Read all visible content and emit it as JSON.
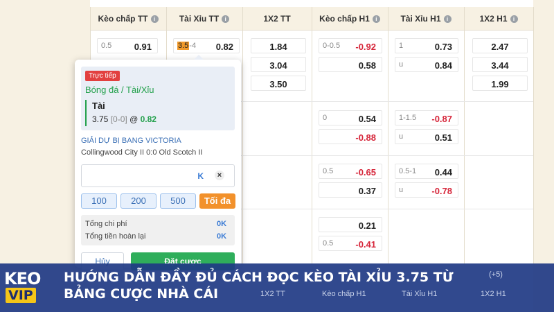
{
  "columns": [
    {
      "label": "Kèo chấp TT",
      "info": true
    },
    {
      "label": "Tài Xỉu TT",
      "info": true
    },
    {
      "label": "1X2 TT",
      "info": false
    },
    {
      "label": "Kèo chấp H1",
      "info": true
    },
    {
      "label": "Tài Xỉu H1",
      "info": true
    },
    {
      "label": "1X2 H1",
      "info": true
    }
  ],
  "info_icon": "i",
  "row1": {
    "handicap_ft": {
      "line": "0.5",
      "odd": "0.91"
    },
    "ou_ft": {
      "line_highlight": "3.5",
      "line_rest": "-4",
      "odd": "0.82"
    },
    "x12_ft": [
      "1.84",
      "3.04",
      "3.50"
    ],
    "handicap_h1": [
      {
        "line": "0-0.5",
        "odd": "-0.92"
      },
      {
        "line": "",
        "odd": "0.58"
      }
    ],
    "ou_h1": [
      {
        "line": "1",
        "odd": "0.73"
      },
      {
        "line": "u",
        "odd": "0.84"
      }
    ],
    "x12_h1": [
      "2.47",
      "3.44",
      "1.99"
    ]
  },
  "row2": {
    "handicap_h1": [
      {
        "line": "0",
        "odd": "0.54"
      },
      {
        "line": "",
        "odd": "-0.88"
      }
    ],
    "ou_h1": [
      {
        "line": "1-1.5",
        "odd": "-0.87"
      },
      {
        "line": "u",
        "odd": "0.51"
      }
    ]
  },
  "row3": {
    "handicap_h1": [
      {
        "line": "0.5",
        "odd": "-0.65"
      },
      {
        "line": "",
        "odd": "0.37"
      }
    ],
    "ou_h1": [
      {
        "line": "0.5-1",
        "odd": "0.44"
      },
      {
        "line": "u",
        "odd": "-0.78"
      }
    ]
  },
  "row4": {
    "handicap_h1": [
      {
        "line": "",
        "odd": "0.21"
      },
      {
        "line": "0.5",
        "odd": "-0.41"
      }
    ]
  },
  "betslip": {
    "live_badge": "Trực tiếp",
    "sport": "Bóng đá / Tài/Xỉu",
    "selection": "Tài",
    "line": "3.75",
    "score": "[0-0]",
    "at": "@",
    "odd": "0.82",
    "league": "GIẢI DỰ BỊ BANG VICTORIA",
    "match": "Collingwood City II 0:0 Old Scotch II",
    "stake_unit": "K",
    "clear_icon": "×",
    "chips": [
      "100",
      "200",
      "500"
    ],
    "max_label": "Tối đa",
    "total_cost_label": "Tổng chi phí",
    "total_cost_value": "0K",
    "total_refund_label": "Tổng tiền hoàn lại",
    "total_refund_value": "0K",
    "cancel_label": "Hủy",
    "place_label": "Đặt cược"
  },
  "footer_ghost": {
    "count": "(+5)",
    "cols": [
      "1X2 TT",
      "Kèo chấp H1",
      "Tài Xỉu H1",
      "1X2 H1"
    ]
  },
  "banner": {
    "logo_top": "KEO",
    "logo_bottom": "VIP",
    "headline": "HƯỚNG DẪN ĐẦY ĐỦ CÁCH ĐỌC KÈO TÀI XỈU 3.75 TỪ BẢNG CƯỢC NHÀ CÁI"
  },
  "colors": {
    "negative": "#d6263a",
    "accent_green": "#22a04b",
    "highlight": "#f19a2b",
    "banner": "#203a84",
    "logo_yellow": "#f5c518"
  }
}
